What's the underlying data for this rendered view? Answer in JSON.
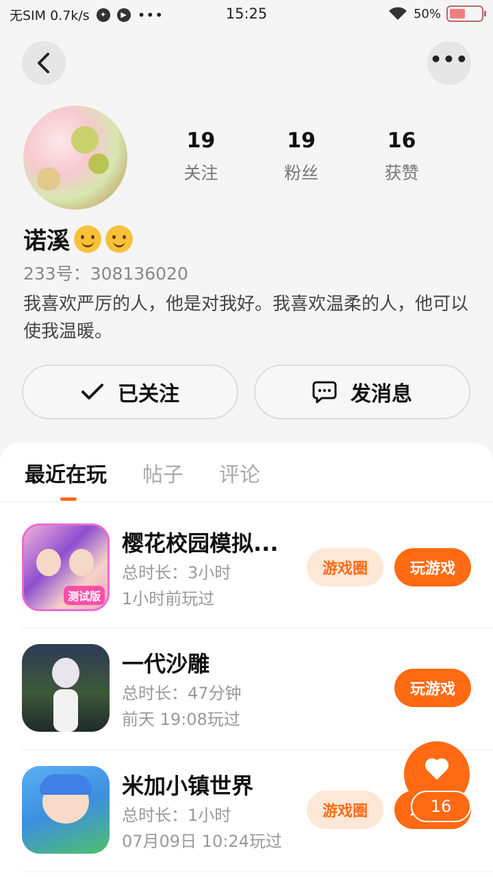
{
  "status_bar": {
    "left_text": "无SIM 0.7k/s",
    "dots": "•••",
    "time": "15:25",
    "battery": "50%",
    "battery_level": 0.5
  },
  "profile": {
    "stats": [
      {
        "count": "19",
        "label": "关注"
      },
      {
        "count": "19",
        "label": "粉丝"
      },
      {
        "count": "16",
        "label": "获赞"
      }
    ],
    "nickname": "诺溪",
    "user_id": "233号：308136020",
    "bio": "我喜欢严厉的人，他是对我好。我喜欢温柔的人，他可以使我温暖。",
    "follow_button": "已关注",
    "message_button": "发消息"
  },
  "tabs": [
    {
      "label": "最近在玩",
      "active": true
    },
    {
      "label": "帖子",
      "active": false
    },
    {
      "label": "评论",
      "active": false
    }
  ],
  "games": [
    {
      "title": "樱花校园模拟...",
      "duration": "总时长：3小时",
      "last_played": "1小时前玩过",
      "icon_tag": "测试版",
      "circle_label": "游戏圈",
      "play_label": "玩游戏"
    },
    {
      "title": "一代沙雕",
      "duration": "总时长：47分钟",
      "last_played": "前天 19:08玩过",
      "icon_tag": "",
      "circle_label": "",
      "play_label": "玩游戏"
    },
    {
      "title": "米加小镇世界",
      "duration": "总时长：1小时",
      "last_played": "07月09日 10:24玩过",
      "icon_tag": "",
      "circle_label": "游戏圈",
      "play_label": "玩游戏"
    }
  ],
  "like_fab": {
    "count": "16"
  },
  "colors": {
    "accent": "#ff6a13",
    "accent_light": "#fde8d8"
  }
}
